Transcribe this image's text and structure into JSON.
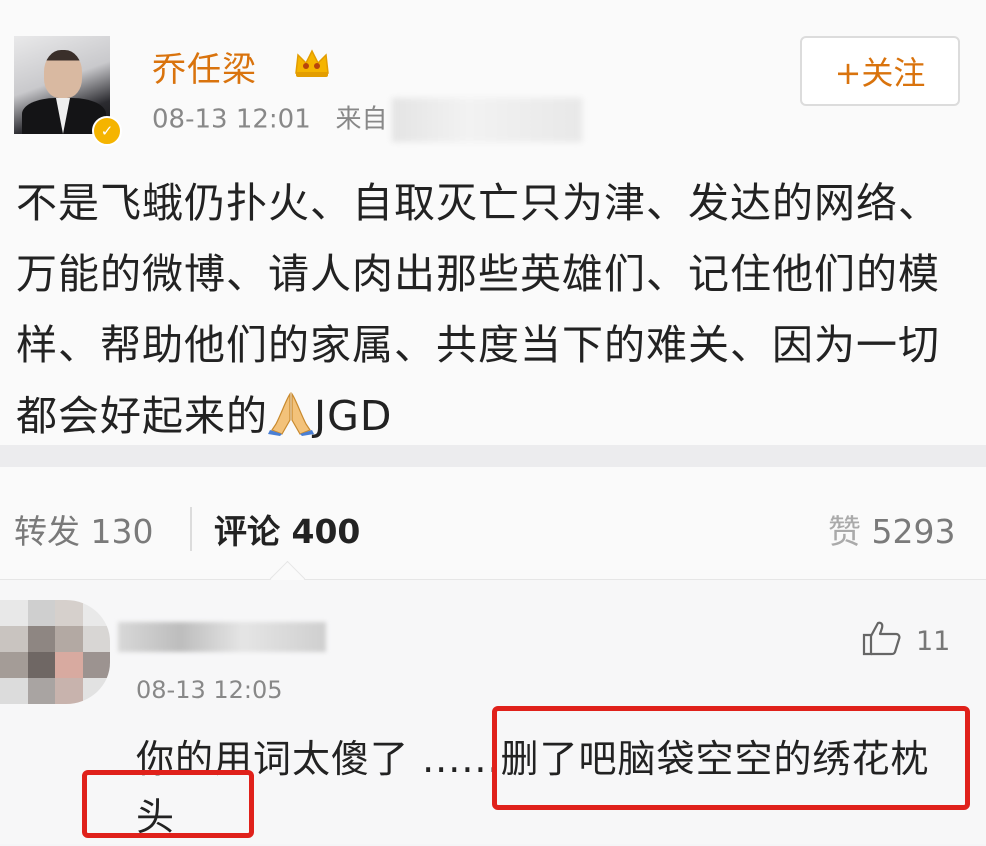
{
  "post": {
    "username": "乔任梁",
    "timestamp": "08-13 12:01",
    "source_prefix": "来自",
    "follow_label": "+关注",
    "content": "不是飞蛾仍扑火、自取灭亡只为津、发达的网络、万能的微博、请人肉出那些英雄们、记住他们的模样、帮助他们的家属、共度当下的难关、因为一切都会好起来的",
    "content_suffix": "JGD",
    "icons": [
      "verified-badge",
      "vip-crown-icon",
      "praying-hands-emoji"
    ]
  },
  "stats": {
    "repost": "转发 130",
    "comment": "评论 400",
    "like_icon": "赞",
    "like_count": "5293"
  },
  "comment": {
    "time": "08-13 12:05",
    "likes": "11",
    "text": "你的用词太傻了 ......删了吧脑袋空空的绣花枕头"
  },
  "colors": {
    "username": "#d9730d",
    "highlight_box": "#e0211b",
    "verified": "#f5b400"
  }
}
